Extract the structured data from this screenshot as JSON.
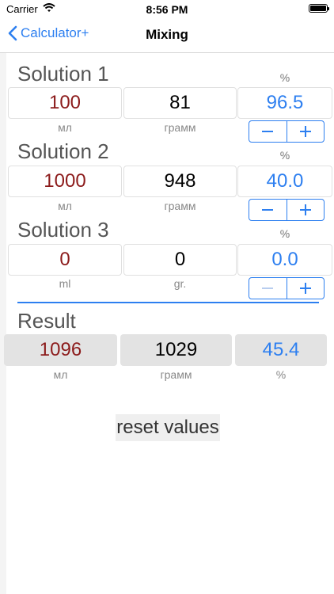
{
  "status_bar": {
    "carrier": "Carrier",
    "time": "8:56 PM"
  },
  "nav": {
    "back_label": "Calculator+",
    "title": "Mixing"
  },
  "solutions": [
    {
      "title": "Solution 1",
      "volume": "100",
      "mass": "81",
      "percent": "96.5",
      "volume_unit": "мл",
      "mass_unit": "грамм",
      "percent_label": "%"
    },
    {
      "title": "Solution 2",
      "volume": "1000",
      "mass": "948",
      "percent": "40.0",
      "volume_unit": "мл",
      "mass_unit": "грамм",
      "percent_label": "%"
    },
    {
      "title": "Solution 3",
      "volume": "0",
      "mass": "0",
      "percent": "0.0",
      "volume_unit": "ml",
      "mass_unit": "gr.",
      "percent_label": "%"
    }
  ],
  "result": {
    "title": "Result",
    "volume": "1096",
    "mass": "1029",
    "percent": "45.4",
    "volume_unit": "мл",
    "mass_unit": "грамм",
    "percent_unit": "%"
  },
  "reset_label": "reset values",
  "colors": {
    "accent": "#2d7ff0",
    "volume_text": "#8c1b1b",
    "result_bg": "#e3e3e3"
  }
}
